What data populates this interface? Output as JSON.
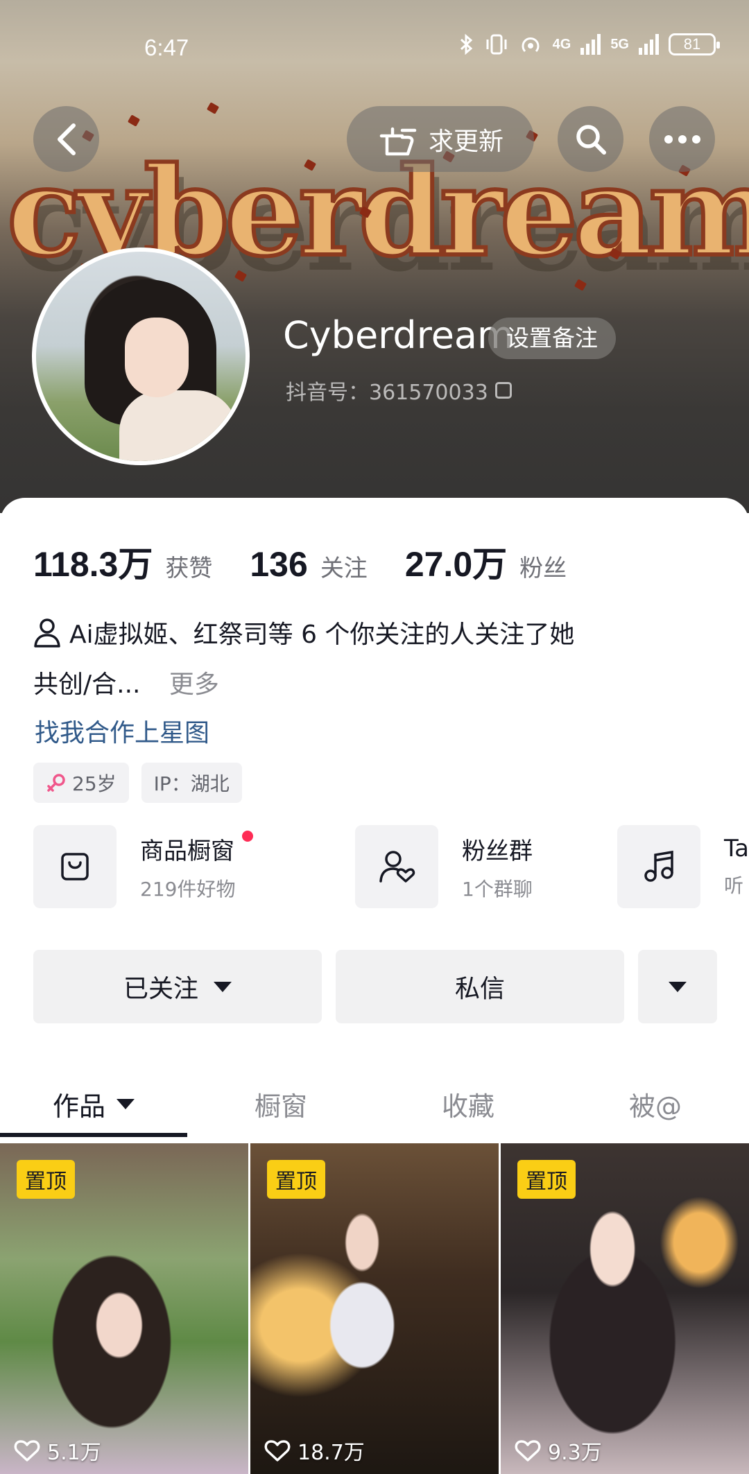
{
  "status_bar": {
    "time": "6:47",
    "signal_1_label": "4G",
    "signal_2_label": "5G",
    "battery": "81"
  },
  "header": {
    "banner_word": "cyberdream",
    "request_update_label": "求更新",
    "icons": [
      "back-icon",
      "finger-point-icon",
      "search-icon",
      "more-icon"
    ]
  },
  "profile": {
    "name": "Cyberdream",
    "remark_button": "设置备注",
    "douyin_id": "抖音号：361570033"
  },
  "stats": [
    {
      "value": "118.3万",
      "label": "获赞"
    },
    {
      "value": "136",
      "label": "关注"
    },
    {
      "value": "27.0万",
      "label": "粉丝"
    }
  ],
  "bio": {
    "mutual_follow": "Ai虚拟姬、红祭司等 6 个你关注的人关注了她",
    "line2": "共创/合...",
    "more": "更多",
    "link": "找我合作上星图"
  },
  "tags": {
    "age": "25岁",
    "ip": "IP：湖北"
  },
  "entries": [
    {
      "title": "商品橱窗",
      "sub": "219件好物",
      "icon": "shopping-bag-icon",
      "has_dot": true
    },
    {
      "title": "粉丝群",
      "sub": "1个群聊",
      "icon": "fan-group-icon",
      "has_dot": false
    },
    {
      "title": "Ta",
      "sub": "听",
      "icon": "music-note-icon",
      "has_dot": false
    }
  ],
  "actions": {
    "followed": "已关注",
    "message": "私信"
  },
  "tabs": [
    "作品",
    "橱窗",
    "收藏",
    "被@"
  ],
  "videos": [
    {
      "pin": "置顶",
      "likes": "5.1万"
    },
    {
      "pin": "置顶",
      "likes": "18.7万"
    },
    {
      "pin": "置顶",
      "likes": "9.3万"
    }
  ],
  "colors": {
    "accent_red": "#fe2c55",
    "pin_yellow": "#face15",
    "link_blue": "#315a8a"
  }
}
